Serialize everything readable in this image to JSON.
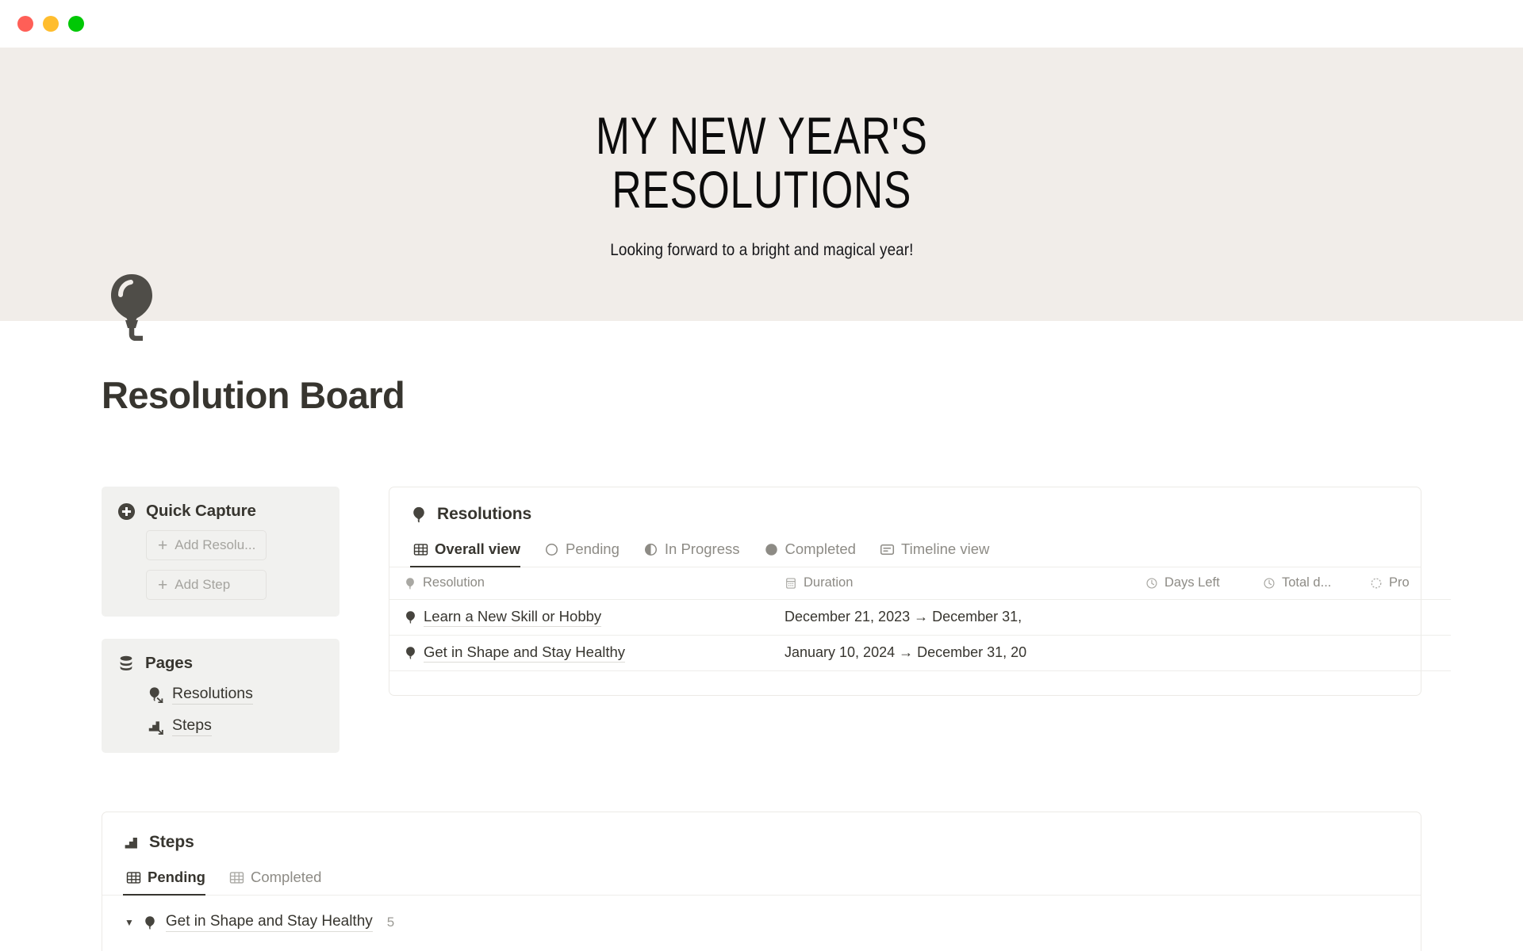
{
  "window": {
    "traffic_lights": [
      "close",
      "minimize",
      "zoom"
    ],
    "colors": {
      "close": "#ff5f57",
      "minimize": "#ffbd2e",
      "zoom": "#00c805"
    }
  },
  "cover": {
    "title": "MY NEW YEAR'S\nRESOLUTIONS",
    "subtitle": "Looking forward to a bright and magical year!",
    "background": "#f1ede9"
  },
  "page": {
    "icon": "balloon-icon",
    "title": "Resolution Board"
  },
  "quick_capture": {
    "icon": "plus-circle-icon",
    "title": "Quick Capture",
    "buttons": [
      {
        "label": "Add Resolu...",
        "icon": "plus-icon"
      },
      {
        "label": "Add Step",
        "icon": "plus-icon"
      }
    ]
  },
  "pages": {
    "icon": "database-stack-icon",
    "title": "Pages",
    "links": [
      {
        "label": "Resolutions",
        "icon": "balloon-link-icon"
      },
      {
        "label": "Steps",
        "icon": "stairs-link-icon"
      }
    ]
  },
  "resolutions_db": {
    "icon": "balloon-icon",
    "title": "Resolutions",
    "tabs": [
      {
        "label": "Overall view",
        "icon": "table-icon",
        "active": true
      },
      {
        "label": "Pending",
        "icon": "circle-empty-icon",
        "active": false
      },
      {
        "label": "In Progress",
        "icon": "circle-half-icon",
        "active": false
      },
      {
        "label": "Completed",
        "icon": "circle-full-icon",
        "active": false
      },
      {
        "label": "Timeline view",
        "icon": "timeline-icon",
        "active": false
      }
    ],
    "columns": [
      {
        "label": "Resolution",
        "icon": "balloon-icon"
      },
      {
        "label": "Duration",
        "icon": "calendar-icon"
      },
      {
        "label": "Days Left",
        "icon": "clock-icon"
      },
      {
        "label": "Total d...",
        "icon": "clock-icon"
      },
      {
        "label": "Pro",
        "icon": "dashed-circle-icon"
      }
    ],
    "rows": [
      {
        "icon": "balloon-icon",
        "resolution": "Learn a New Skill or Hobby",
        "duration": "December 21, 2023 → December 31,",
        "days_left": "",
        "total_days": "",
        "progress": ""
      },
      {
        "icon": "balloon-icon",
        "resolution": "Get in Shape and Stay Healthy",
        "duration": "January 10, 2024 → December 31, 20",
        "days_left": "",
        "total_days": "",
        "progress": ""
      }
    ]
  },
  "steps_db": {
    "icon": "stairs-icon",
    "title": "Steps",
    "tabs": [
      {
        "label": "Pending",
        "icon": "table-icon",
        "active": true
      },
      {
        "label": "Completed",
        "icon": "table-icon",
        "active": false
      }
    ],
    "groups": [
      {
        "arrow": "▼",
        "icon": "balloon-icon",
        "name": "Get in Shape and Stay Healthy",
        "count": "5"
      }
    ]
  }
}
